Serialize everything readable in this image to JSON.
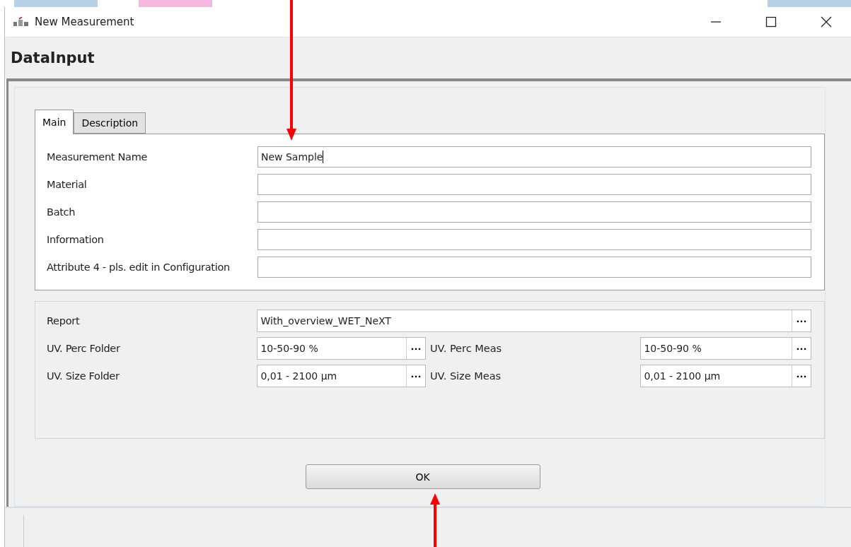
{
  "window": {
    "title": "New Measurement"
  },
  "header": "DataInput",
  "tabs": [
    {
      "label": "Main",
      "selected": true
    },
    {
      "label": "Description",
      "selected": false
    }
  ],
  "main_fields": [
    {
      "label": "Measurement Name",
      "value": "New Sample",
      "focused": true
    },
    {
      "label": "Material",
      "focused": false
    },
    {
      "label": "Batch",
      "focused": false
    },
    {
      "label": "Information",
      "focused": false
    },
    {
      "label": "Attribute 4 - pls. edit in Configuration",
      "focused": false
    }
  ],
  "report": {
    "label": "Report",
    "value": "With_overview_WET_NeXT",
    "browse": "···"
  },
  "pair_rows": [
    {
      "left": {
        "label": "UV. Perc Folder",
        "value": "10-50-90 %",
        "browse": "···"
      },
      "right": {
        "label": "UV. Perc Meas",
        "value": "10-50-90 %",
        "browse": "···"
      }
    },
    {
      "left": {
        "label": "UV. Size Folder",
        "value": "0,01 - 2100 µm",
        "browse": "···"
      },
      "right": {
        "label": "UV. Size Meas",
        "value": "0,01 - 2100 µm",
        "browse": "···"
      }
    }
  ],
  "ok_button": "OK"
}
